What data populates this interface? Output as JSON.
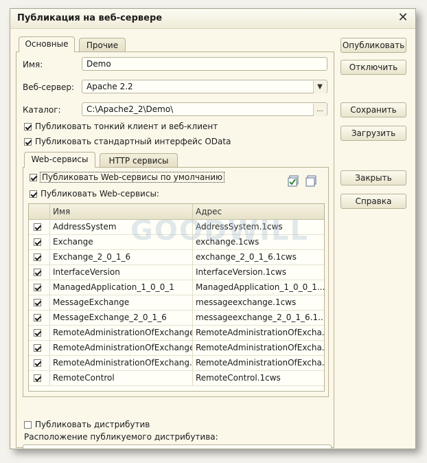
{
  "window": {
    "title": "Публикация на веб-сервере",
    "close_glyph": "✕"
  },
  "tabs": [
    {
      "label": "Основные"
    },
    {
      "label": "Прочие"
    }
  ],
  "form": {
    "name_label": "Имя:",
    "name_value": "Demo",
    "server_label": "Веб-сервер:",
    "server_value": "Apache 2.2",
    "catalog_label": "Каталог:",
    "catalog_value": "C:\\Apache2_2\\Demo\\",
    "dots": "..."
  },
  "options": {
    "thin_client": "Публиковать тонкий клиент и веб-клиент",
    "odata": "Публиковать стандартный интерфейс OData"
  },
  "subtabs": [
    {
      "label": "Web-сервисы"
    },
    {
      "label": "HTTP сервисы"
    }
  ],
  "services": {
    "default_label": "Публиковать Web-сервисы по умолчанию",
    "publish_label": "Публиковать Web-сервисы:",
    "columns": {
      "name": "Имя",
      "address": "Адрес"
    },
    "rows": [
      {
        "name": "AddressSystem",
        "address": "AddressSystem.1cws"
      },
      {
        "name": "Exchange",
        "address": "exchange.1cws"
      },
      {
        "name": "Exchange_2_0_1_6",
        "address": "exchange_2_0_1_6.1cws"
      },
      {
        "name": "InterfaceVersion",
        "address": "InterfaceVersion.1cws"
      },
      {
        "name": "ManagedApplication_1_0_0_1",
        "address": "ManagedApplication_1_0_0_1..."
      },
      {
        "name": "MessageExchange",
        "address": "messageexchange.1cws"
      },
      {
        "name": "MessageExchange_2_0_1_6",
        "address": "messageexchange_2_0_1_6.1..."
      },
      {
        "name": "RemoteAdministrationOfExchange",
        "address": "RemoteAdministrationOfExcha..."
      },
      {
        "name": "RemoteAdministrationOfExchange...",
        "address": "RemoteAdministrationOfExcha..."
      },
      {
        "name": "RemoteAdministrationOfExchang...",
        "address": "RemoteAdministrationOfExcha..."
      },
      {
        "name": "RemoteControl",
        "address": "RemoteControl.1cws"
      }
    ]
  },
  "distrib": {
    "publish_label": "Публиковать дистрибутив",
    "location_label": "Расположение публикуемого дистрибутива:"
  },
  "buttons": {
    "publish": "Опубликовать",
    "disable": "Отключить",
    "save": "Сохранить",
    "load": "Загрузить",
    "close": "Закрыть",
    "help": "Справка"
  },
  "watermark": {
    "logo": "GOODWILL"
  }
}
